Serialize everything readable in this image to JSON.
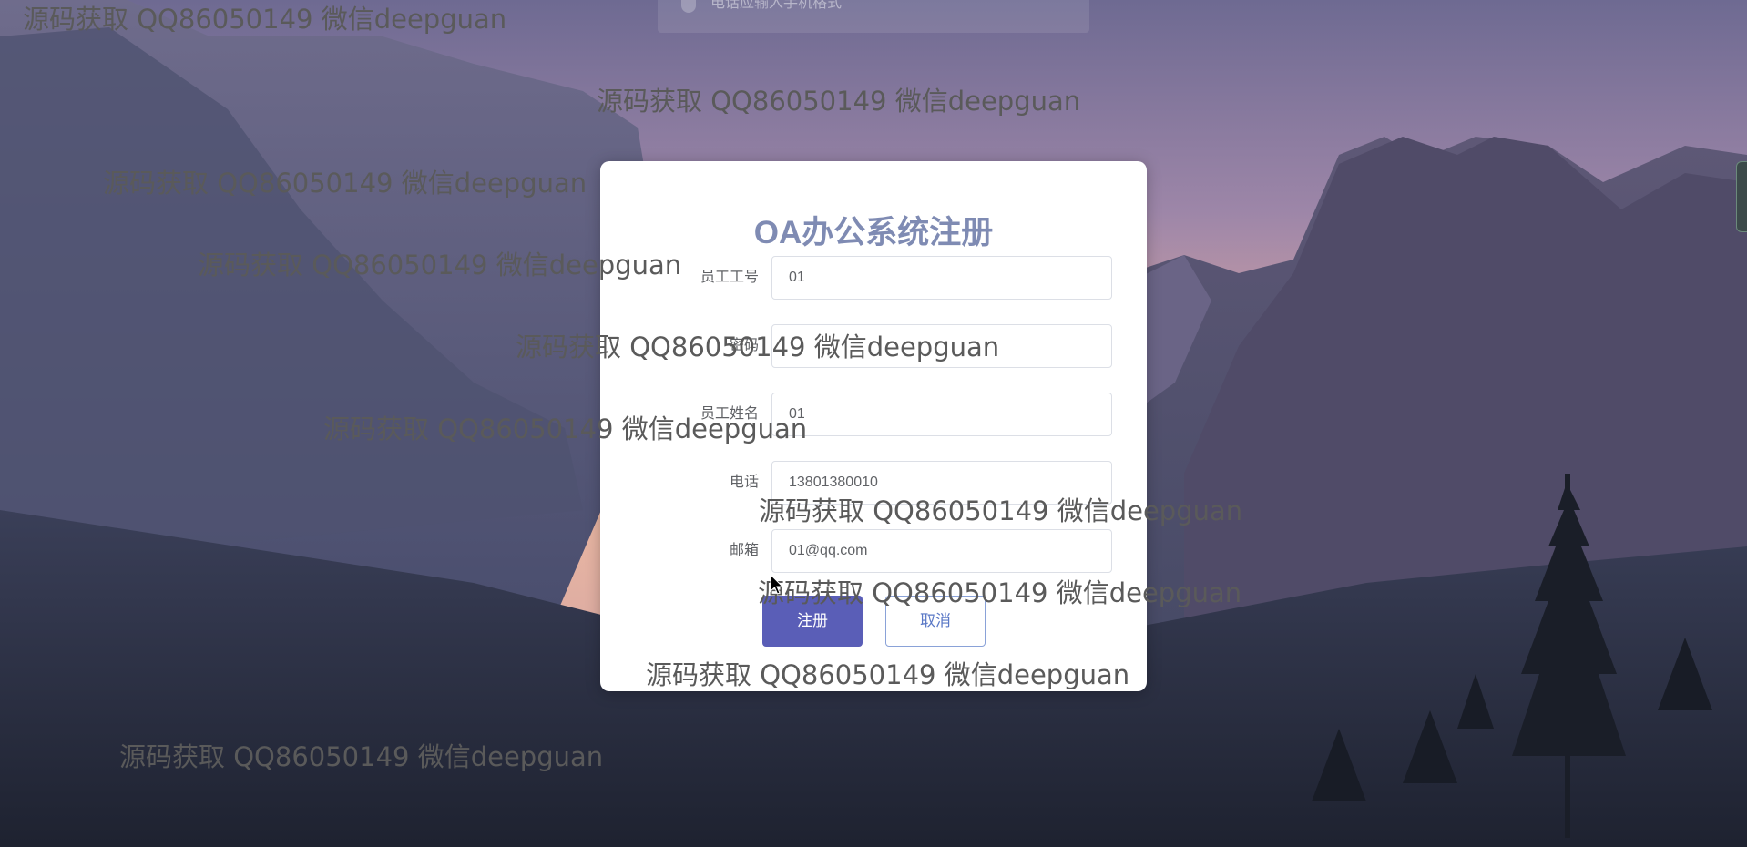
{
  "toast": {
    "message": "电话应输入手机格式"
  },
  "dialog": {
    "title": "OA办公系统注册",
    "fields": [
      {
        "label": "员工工号",
        "value": "01"
      },
      {
        "label": "密码",
        "value": ""
      },
      {
        "label": "员工姓名",
        "value": "01"
      },
      {
        "label": "电话",
        "value": "13801380010"
      },
      {
        "label": "邮箱",
        "value": "01@qq.com"
      }
    ],
    "register_button": "注册",
    "cancel_button": "取消"
  },
  "watermark": {
    "text": "源码获取 QQ86050149 微信deepguan",
    "color": "#5a5a5a"
  },
  "colors": {
    "title": "#7f8bb3",
    "primary_button": "#5a5eb7",
    "cancel_text": "#5a78c6"
  }
}
